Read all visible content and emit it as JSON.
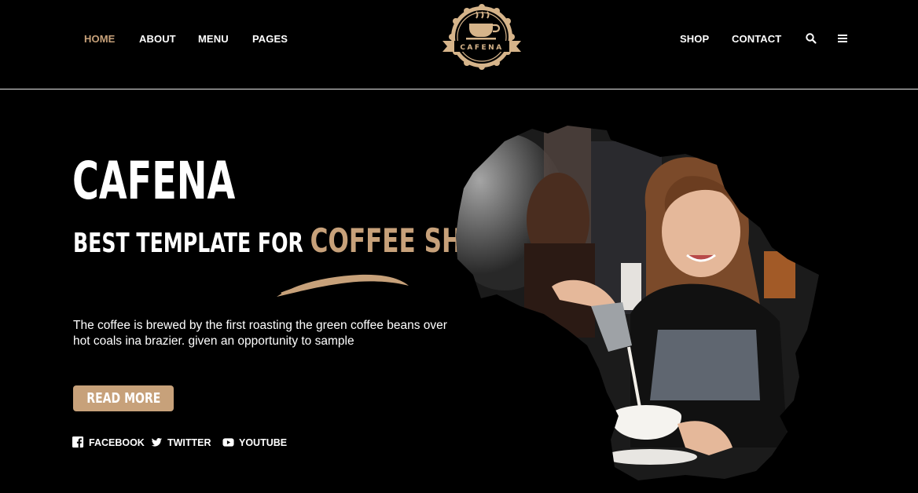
{
  "header": {
    "nav_left": [
      "HOME",
      "ABOUT",
      "MENU",
      "PAGES"
    ],
    "nav_right": [
      "SHOP",
      "CONTACT"
    ],
    "logo_text": "CAFENA",
    "icons": [
      "search-icon",
      "menu-icon"
    ]
  },
  "hero": {
    "title": "CAFENA",
    "subtitle_plain": "BEST TEMPLATE FOR",
    "subtitle_accent": "COFFEE SHOP",
    "description": "The coffee is brewed by the first roasting the green coffee beans over hot coals ina brazier. given an opportunity to sample",
    "cta_label": "READ MORE",
    "social": [
      "FACEBOOK",
      "TWITTER",
      "YOUTUBE"
    ]
  },
  "colors": {
    "accent": "#c7a17a",
    "background": "#000000",
    "text": "#ffffff"
  }
}
